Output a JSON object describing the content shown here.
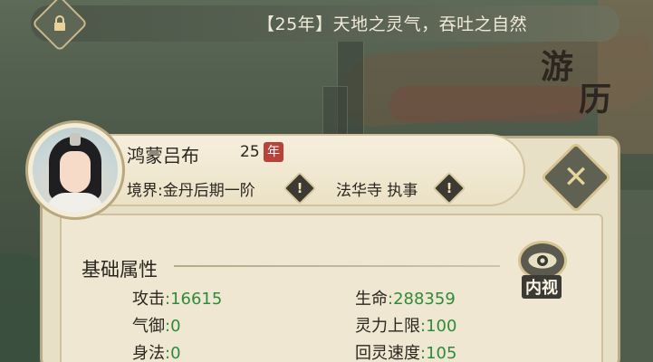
{
  "ticker": {
    "text": "【25年】天地之灵气，吞吐之自然"
  },
  "background": {
    "map_title": "游历",
    "map_title_chars": [
      "游",
      "历"
    ]
  },
  "character": {
    "name": "鸿蒙吕布",
    "age": "25",
    "age_unit": "年",
    "realm_label": "境界:",
    "realm_value": "金丹后期一阶",
    "sect": "法华寺 执事"
  },
  "panel": {
    "section_title": "基础属性",
    "inspect_label": "内视"
  },
  "stats": {
    "attack": {
      "label": "攻击",
      "value": ":16615"
    },
    "hp": {
      "label": "生命",
      "value": ":288359"
    },
    "qi_defense": {
      "label": "气御",
      "value": ":0"
    },
    "spirit_cap": {
      "label": "灵力上限",
      "value": ":100"
    },
    "agility": {
      "label": "身法",
      "value": ":0"
    },
    "regen_speed": {
      "label": "回灵速度",
      "value": ":105"
    }
  },
  "icons": {
    "lock": "lock-icon",
    "close": "close-icon",
    "info": "exclamation-icon",
    "eye": "eye-icon"
  },
  "colors": {
    "stat_value": "#2f8b3a",
    "year_badge": "#b8413a",
    "panel": "#e8dfc7"
  }
}
